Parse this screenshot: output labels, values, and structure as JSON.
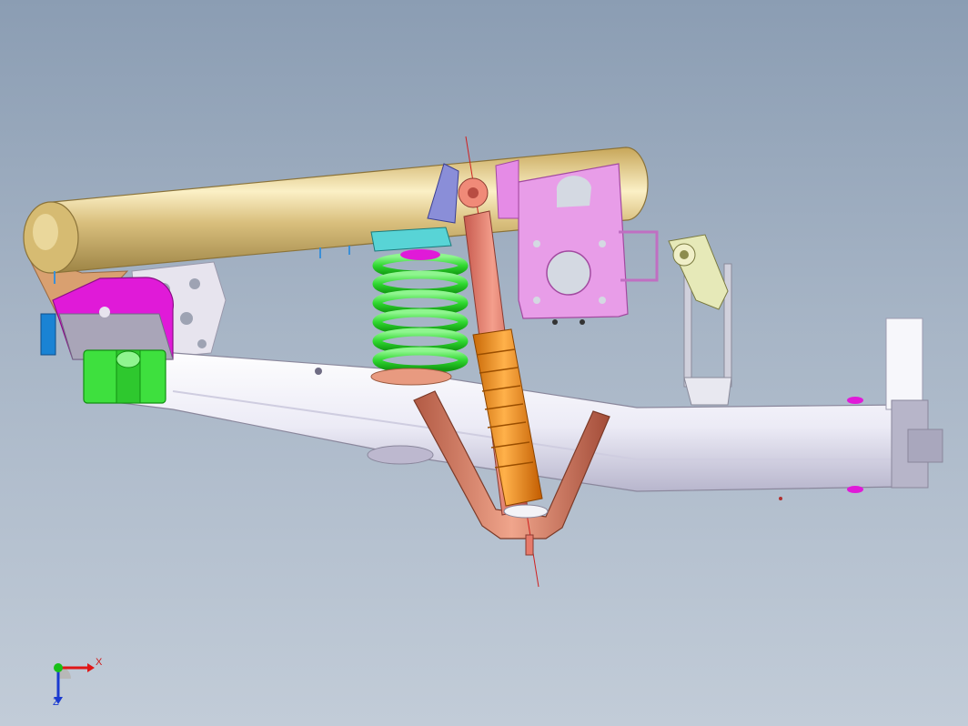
{
  "viewport": {
    "background_top": "#8b9db3",
    "background_bottom": "#c2ccd8"
  },
  "model": {
    "parts": [
      {
        "id": "frame-tube",
        "color": "#d6bd7a"
      },
      {
        "id": "trailing-arm",
        "color": "#ecebf6"
      },
      {
        "id": "coil-spring",
        "color": "#2fd82f"
      },
      {
        "id": "shock-absorber-body",
        "color": "#e67a6a"
      },
      {
        "id": "shock-absorber-sleeve",
        "color": "#f08c1a"
      },
      {
        "id": "lower-shock-bracket",
        "color": "#d9886e"
      },
      {
        "id": "upper-mount-bracket",
        "color": "#e48bea"
      },
      {
        "id": "front-pivot-bracket",
        "color": "#e01ad8"
      },
      {
        "id": "front-bushing",
        "color": "#3ee03e"
      },
      {
        "id": "spring-seat-upper",
        "color": "#36c6c8"
      },
      {
        "id": "rear-link",
        "color": "#c9c9c9"
      },
      {
        "id": "end-block",
        "color": "#b7b5c9"
      }
    ]
  },
  "triad": {
    "x_label": "X",
    "z_label": "Z",
    "x_color": "#e01616",
    "y_color": "#18c018",
    "z_color": "#1a3ad0"
  }
}
